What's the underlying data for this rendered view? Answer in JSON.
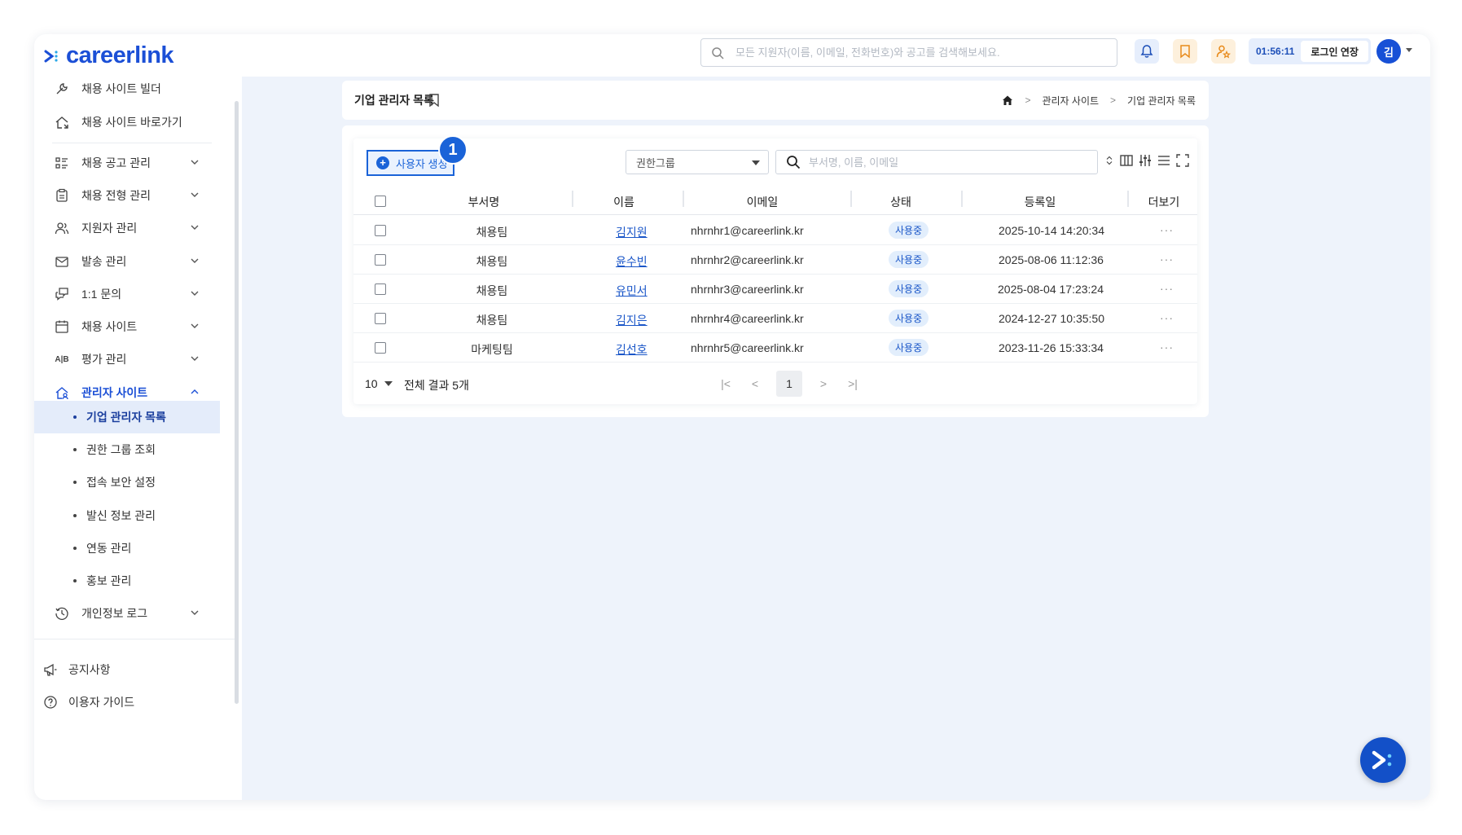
{
  "brand": {
    "name": "careerlink"
  },
  "header": {
    "search_placeholder": "모든 지원자(이름, 이메일, 전화번호)와 공고를 검색해보세요.",
    "session_timer": "01:56:11",
    "extend_label": "로그인 연장",
    "avatar_initial": "김"
  },
  "sidebar": {
    "top_items": [
      {
        "label": "채용 사이트 빌더",
        "icon": "tools-icon"
      },
      {
        "label": "채용 사이트 바로가기",
        "icon": "home-link-icon"
      }
    ],
    "menu": [
      {
        "label": "채용 공고 관리",
        "icon": "list-icon"
      },
      {
        "label": "채용 전형 관리",
        "icon": "clipboard-icon"
      },
      {
        "label": "지원자 관리",
        "icon": "users-icon"
      },
      {
        "label": "발송 관리",
        "icon": "mail-icon"
      },
      {
        "label": "1:1 문의",
        "icon": "chat-icon"
      },
      {
        "label": "채용 사이트",
        "icon": "calendar-icon"
      },
      {
        "label": "평가 관리",
        "icon": "ab-icon",
        "icon_text": "A|B"
      },
      {
        "label": "관리자 사이트",
        "icon": "admin-home-icon"
      }
    ],
    "submenu": [
      {
        "label": "기업 관리자 목록",
        "selected": true
      },
      {
        "label": "권한 그룹 조회"
      },
      {
        "label": "접속 보안 설정"
      },
      {
        "label": "발신 정보 관리"
      },
      {
        "label": "연동 관리"
      },
      {
        "label": "홍보 관리"
      }
    ],
    "privacy_log": "개인정보 로그",
    "footer": [
      {
        "label": "공지사항",
        "icon": "megaphone-icon"
      },
      {
        "label": "이용자 가이드",
        "icon": "help-icon"
      }
    ]
  },
  "page": {
    "title": "기업 관리자 목록",
    "breadcrumb": [
      "관리자 사이트",
      "기업 관리자 목록"
    ]
  },
  "toolbar": {
    "create_label": "사용자 생성",
    "step_number": "1",
    "group_select": "권한그룹",
    "search_placeholder": "부서명, 이름, 이메일"
  },
  "table": {
    "columns": [
      "부서명",
      "이름",
      "이메일",
      "상태",
      "등록일",
      "더보기"
    ],
    "rows": [
      {
        "dept": "채용팀",
        "name": "김지원",
        "email": "nhrnhr1@careerlink.kr",
        "status": "사용중",
        "date": "2025-10-14 14:20:34"
      },
      {
        "dept": "채용팀",
        "name": "윤수빈",
        "email": "nhrnhr2@careerlink.kr",
        "status": "사용중",
        "date": "2025-08-06 11:12:36"
      },
      {
        "dept": "채용팀",
        "name": "유민서",
        "email": "nhrnhr3@careerlink.kr",
        "status": "사용중",
        "date": "2025-08-04 17:23:24"
      },
      {
        "dept": "채용팀",
        "name": "김지은",
        "email": "nhrnhr4@careerlink.kr",
        "status": "사용중",
        "date": "2024-12-27 10:35:50"
      },
      {
        "dept": "마케팅팀",
        "name": "김선호",
        "email": "nhrnhr5@careerlink.kr",
        "status": "사용중",
        "date": "2023-11-26 15:33:34"
      }
    ],
    "more_glyph": "···"
  },
  "pagination": {
    "page_size": "10",
    "total_label": "전체 결과 5개",
    "current_page": "1"
  },
  "colors": {
    "brand": "#1b4fd6",
    "accent": "#1a63d8",
    "background": "#eef3fb"
  }
}
